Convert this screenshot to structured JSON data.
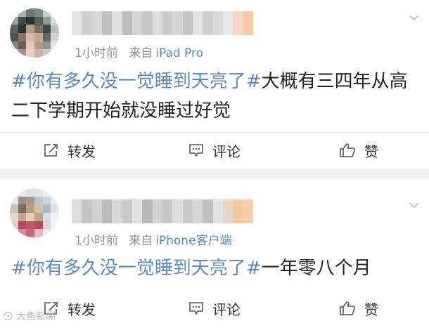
{
  "posts": [
    {
      "time": "1小时前",
      "source_prefix": "来自",
      "source": "iPad Pro",
      "hashtag": "#你有多久没一觉睡到天亮了#",
      "text": "大概有三四年从高二下学期开始就没睡过好觉",
      "actions": {
        "share": "转发",
        "comment": "评论",
        "like": "赞"
      }
    },
    {
      "time": "1小时前",
      "source_prefix": "来自",
      "source": "iPhone客户端",
      "hashtag": "#你有多久没一觉睡到天亮了#",
      "text": "一年零八个月",
      "actions": {
        "share": "转发",
        "comment": "评论",
        "like": "赞"
      }
    }
  ],
  "watermark": "大鱼新闻",
  "icons": [
    "share-icon",
    "comment-icon",
    "like-icon",
    "chevron-down-icon"
  ],
  "colors": {
    "link": "#5a8ac2",
    "meta": "#939393",
    "text": "#222222",
    "separator": "#f0f0f0"
  }
}
